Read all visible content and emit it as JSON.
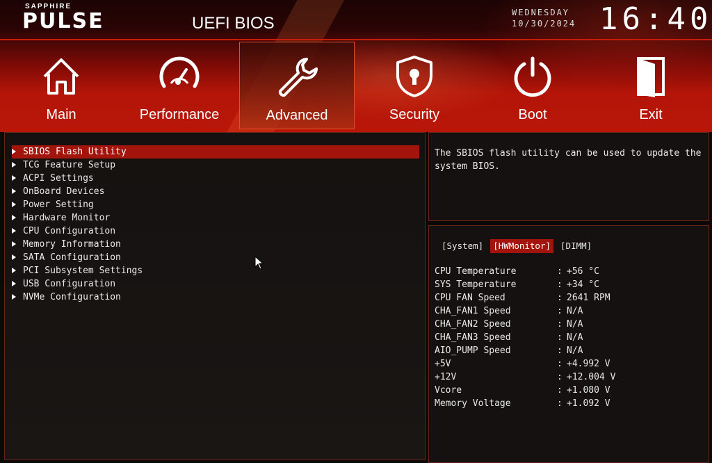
{
  "brand": {
    "small": "SAPPHIRE",
    "main": "PULSE"
  },
  "title": "UEFI BIOS",
  "clock": {
    "day": "WEDNESDAY",
    "date": "10/30/2024",
    "time": "16:40"
  },
  "nav": [
    {
      "label": "Main",
      "icon": "home-icon"
    },
    {
      "label": "Performance",
      "icon": "gauge-icon"
    },
    {
      "label": "Advanced",
      "icon": "wrench-icon"
    },
    {
      "label": "Security",
      "icon": "shield-lock-icon"
    },
    {
      "label": "Boot",
      "icon": "power-icon"
    },
    {
      "label": "Exit",
      "icon": "door-icon"
    }
  ],
  "active_nav": "Advanced",
  "menu": [
    "SBIOS Flash Utility",
    "TCG Feature Setup",
    "ACPI Settings",
    "OnBoard Devices",
    "Power Setting",
    "Hardware Monitor",
    "CPU Configuration",
    "Memory Information",
    "SATA Configuration",
    "PCI Subsystem Settings",
    "USB Configuration",
    "NVMe Configuration"
  ],
  "selected_menu": "SBIOS Flash Utility",
  "help": "The SBIOS flash utility can be used to update the system BIOS.",
  "tabs": [
    "[System]",
    "[HWMonitor]",
    "[DIMM]"
  ],
  "active_tab": "[HWMonitor]",
  "hardware": [
    {
      "label": "CPU Temperature",
      "value": "+56 °C"
    },
    {
      "label": "SYS Temperature",
      "value": "+34 °C"
    },
    {
      "label": "CPU FAN Speed",
      "value": "2641 RPM"
    },
    {
      "label": "CHA_FAN1 Speed",
      "value": "N/A"
    },
    {
      "label": "CHA_FAN2 Speed",
      "value": "N/A"
    },
    {
      "label": "CHA_FAN3 Speed",
      "value": "N/A"
    },
    {
      "label": "AIO_PUMP Speed",
      "value": "N/A"
    },
    {
      "label": "+5V",
      "value": "+4.992 V"
    },
    {
      "label": "+12V",
      "value": "+12.004 V"
    },
    {
      "label": "Vcore",
      "value": "+1.080 V"
    },
    {
      "label": "Memory Voltage",
      "value": "+1.092 V"
    }
  ],
  "separator": ":",
  "colors": {
    "accent": "#a3150c",
    "border": "#6a2418",
    "header_red": "#b81608",
    "background": "#0c0a09"
  }
}
